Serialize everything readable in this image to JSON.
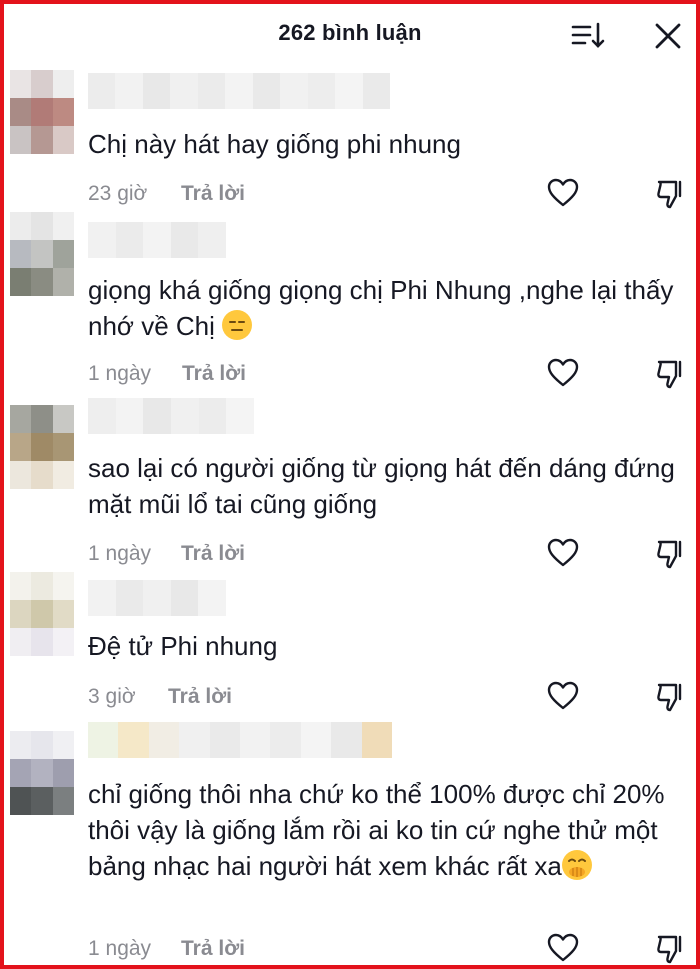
{
  "header": {
    "title": "262 bình luận"
  },
  "comments": [
    {
      "text": "Chị này hát hay giống phi nhung",
      "time": "23 giờ",
      "reply": "Trả lời"
    },
    {
      "text": "giọng khá giống giọng chị Phi Nhung ,nghe lại thấy nhớ về Chị ",
      "emoji": "expressionless-face-emoji",
      "time": "1 ngày",
      "reply": "Trả lời"
    },
    {
      "text": "sao lại có người giống từ giọng hát đến dáng đứng mặt mũi lổ tai cũng giống",
      "time": "1 ngày",
      "reply": "Trả lời"
    },
    {
      "text": "Đệ tử Phi nhung",
      "time": "3 giờ",
      "reply": "Trả lời"
    },
    {
      "text": "chỉ giống thôi nha chứ ko thể 100% được chỉ 20% thôi vậy là giống lắm rồi ai ko tin cứ nghe thử một bảng nhạc hai người hát xem khác rất xa",
      "emoji": "hand-over-mouth-emoji",
      "time": "1 ngày",
      "reply": "Trả lời"
    }
  ],
  "colors": {
    "frame": "#e3121b",
    "meta": "#8a8b91",
    "text": "#161823"
  }
}
